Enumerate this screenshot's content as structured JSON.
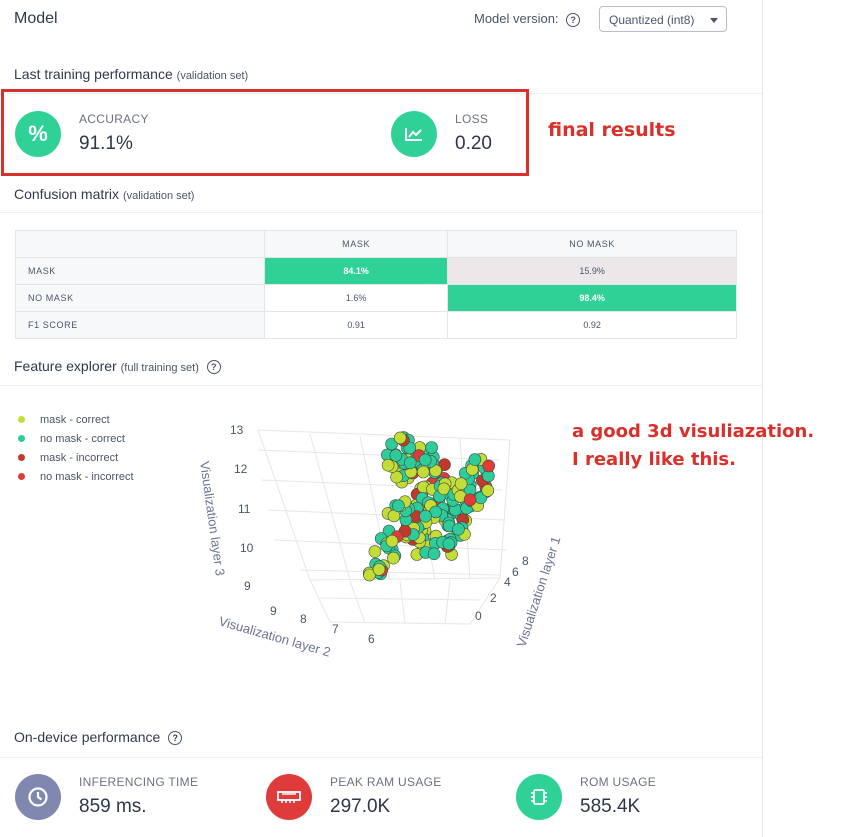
{
  "header": {
    "title": "Model",
    "model_version_label": "Model version:",
    "model_version_value": "Quantized (int8)"
  },
  "training": {
    "title": "Last training performance",
    "subtitle": "(validation set)",
    "accuracy": {
      "label": "ACCURACY",
      "value": "91.1%",
      "icon": "percent-icon",
      "color": "#2fd196"
    },
    "loss": {
      "label": "LOSS",
      "value": "0.20",
      "icon": "trend-chart-icon",
      "color": "#2fd196"
    }
  },
  "annotations": {
    "final": "final results",
    "viz_line1": "a good 3d visuliazation.",
    "viz_line2": "I really like this."
  },
  "confusion": {
    "title": "Confusion matrix",
    "subtitle": "(validation set)",
    "columns": [
      "MASK",
      "NO MASK"
    ],
    "rows": [
      {
        "label": "MASK",
        "cells": [
          "84.1%",
          "15.9%"
        ]
      },
      {
        "label": "NO MASK",
        "cells": [
          "1.6%",
          "98.4%"
        ]
      },
      {
        "label": "F1 SCORE",
        "cells": [
          "0.91",
          "0.92"
        ]
      }
    ]
  },
  "features": {
    "title": "Feature explorer",
    "subtitle": "(full training set)",
    "legend": [
      {
        "label": "mask - correct",
        "color": "#c3dc36"
      },
      {
        "label": "no mask - correct",
        "color": "#2ecc9a"
      },
      {
        "label": "mask - incorrect",
        "color": "#c0392b"
      },
      {
        "label": "no mask - incorrect",
        "color": "#e03b3b"
      }
    ],
    "axis_z_title": "Visualization layer 3",
    "axis_x_title": "Visualization layer 2",
    "axis_y_title": "Visualization layer 1",
    "z_ticks": [
      "13",
      "12",
      "11",
      "10",
      "9"
    ],
    "x_ticks": [
      "9",
      "8",
      "7",
      "6"
    ],
    "y_ticks": [
      "8",
      "6",
      "4",
      "2",
      "0"
    ]
  },
  "device": {
    "title": "On-device performance",
    "inferencing": {
      "label": "INFERENCING TIME",
      "value": "859 ms.",
      "icon": "clock-icon",
      "color": "#8088b0"
    },
    "ram": {
      "label": "PEAK RAM USAGE",
      "value": "297.0K",
      "icon": "ram-chip-icon",
      "color": "#e03b3b"
    },
    "rom": {
      "label": "ROM USAGE",
      "value": "585.4K",
      "icon": "rom-chip-icon",
      "color": "#2fd196"
    }
  }
}
